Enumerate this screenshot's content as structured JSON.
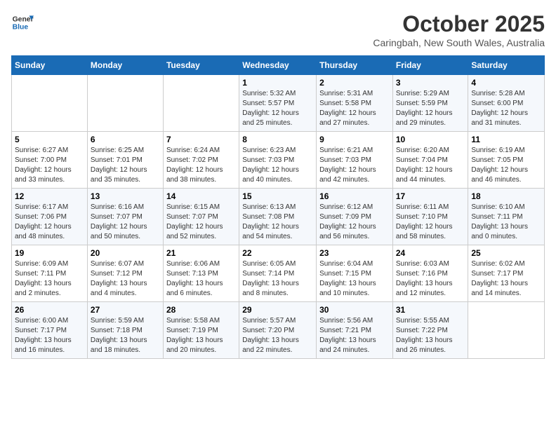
{
  "header": {
    "logo_general": "General",
    "logo_blue": "Blue",
    "month_title": "October 2025",
    "location": "Caringbah, New South Wales, Australia"
  },
  "weekdays": [
    "Sunday",
    "Monday",
    "Tuesday",
    "Wednesday",
    "Thursday",
    "Friday",
    "Saturday"
  ],
  "weeks": [
    [
      {
        "day": "",
        "info": ""
      },
      {
        "day": "",
        "info": ""
      },
      {
        "day": "",
        "info": ""
      },
      {
        "day": "1",
        "info": "Sunrise: 5:32 AM\nSunset: 5:57 PM\nDaylight: 12 hours\nand 25 minutes."
      },
      {
        "day": "2",
        "info": "Sunrise: 5:31 AM\nSunset: 5:58 PM\nDaylight: 12 hours\nand 27 minutes."
      },
      {
        "day": "3",
        "info": "Sunrise: 5:29 AM\nSunset: 5:59 PM\nDaylight: 12 hours\nand 29 minutes."
      },
      {
        "day": "4",
        "info": "Sunrise: 5:28 AM\nSunset: 6:00 PM\nDaylight: 12 hours\nand 31 minutes."
      }
    ],
    [
      {
        "day": "5",
        "info": "Sunrise: 6:27 AM\nSunset: 7:00 PM\nDaylight: 12 hours\nand 33 minutes."
      },
      {
        "day": "6",
        "info": "Sunrise: 6:25 AM\nSunset: 7:01 PM\nDaylight: 12 hours\nand 35 minutes."
      },
      {
        "day": "7",
        "info": "Sunrise: 6:24 AM\nSunset: 7:02 PM\nDaylight: 12 hours\nand 38 minutes."
      },
      {
        "day": "8",
        "info": "Sunrise: 6:23 AM\nSunset: 7:03 PM\nDaylight: 12 hours\nand 40 minutes."
      },
      {
        "day": "9",
        "info": "Sunrise: 6:21 AM\nSunset: 7:03 PM\nDaylight: 12 hours\nand 42 minutes."
      },
      {
        "day": "10",
        "info": "Sunrise: 6:20 AM\nSunset: 7:04 PM\nDaylight: 12 hours\nand 44 minutes."
      },
      {
        "day": "11",
        "info": "Sunrise: 6:19 AM\nSunset: 7:05 PM\nDaylight: 12 hours\nand 46 minutes."
      }
    ],
    [
      {
        "day": "12",
        "info": "Sunrise: 6:17 AM\nSunset: 7:06 PM\nDaylight: 12 hours\nand 48 minutes."
      },
      {
        "day": "13",
        "info": "Sunrise: 6:16 AM\nSunset: 7:07 PM\nDaylight: 12 hours\nand 50 minutes."
      },
      {
        "day": "14",
        "info": "Sunrise: 6:15 AM\nSunset: 7:07 PM\nDaylight: 12 hours\nand 52 minutes."
      },
      {
        "day": "15",
        "info": "Sunrise: 6:13 AM\nSunset: 7:08 PM\nDaylight: 12 hours\nand 54 minutes."
      },
      {
        "day": "16",
        "info": "Sunrise: 6:12 AM\nSunset: 7:09 PM\nDaylight: 12 hours\nand 56 minutes."
      },
      {
        "day": "17",
        "info": "Sunrise: 6:11 AM\nSunset: 7:10 PM\nDaylight: 12 hours\nand 58 minutes."
      },
      {
        "day": "18",
        "info": "Sunrise: 6:10 AM\nSunset: 7:11 PM\nDaylight: 13 hours\nand 0 minutes."
      }
    ],
    [
      {
        "day": "19",
        "info": "Sunrise: 6:09 AM\nSunset: 7:11 PM\nDaylight: 13 hours\nand 2 minutes."
      },
      {
        "day": "20",
        "info": "Sunrise: 6:07 AM\nSunset: 7:12 PM\nDaylight: 13 hours\nand 4 minutes."
      },
      {
        "day": "21",
        "info": "Sunrise: 6:06 AM\nSunset: 7:13 PM\nDaylight: 13 hours\nand 6 minutes."
      },
      {
        "day": "22",
        "info": "Sunrise: 6:05 AM\nSunset: 7:14 PM\nDaylight: 13 hours\nand 8 minutes."
      },
      {
        "day": "23",
        "info": "Sunrise: 6:04 AM\nSunset: 7:15 PM\nDaylight: 13 hours\nand 10 minutes."
      },
      {
        "day": "24",
        "info": "Sunrise: 6:03 AM\nSunset: 7:16 PM\nDaylight: 13 hours\nand 12 minutes."
      },
      {
        "day": "25",
        "info": "Sunrise: 6:02 AM\nSunset: 7:17 PM\nDaylight: 13 hours\nand 14 minutes."
      }
    ],
    [
      {
        "day": "26",
        "info": "Sunrise: 6:00 AM\nSunset: 7:17 PM\nDaylight: 13 hours\nand 16 minutes."
      },
      {
        "day": "27",
        "info": "Sunrise: 5:59 AM\nSunset: 7:18 PM\nDaylight: 13 hours\nand 18 minutes."
      },
      {
        "day": "28",
        "info": "Sunrise: 5:58 AM\nSunset: 7:19 PM\nDaylight: 13 hours\nand 20 minutes."
      },
      {
        "day": "29",
        "info": "Sunrise: 5:57 AM\nSunset: 7:20 PM\nDaylight: 13 hours\nand 22 minutes."
      },
      {
        "day": "30",
        "info": "Sunrise: 5:56 AM\nSunset: 7:21 PM\nDaylight: 13 hours\nand 24 minutes."
      },
      {
        "day": "31",
        "info": "Sunrise: 5:55 AM\nSunset: 7:22 PM\nDaylight: 13 hours\nand 26 minutes."
      },
      {
        "day": "",
        "info": ""
      }
    ]
  ]
}
